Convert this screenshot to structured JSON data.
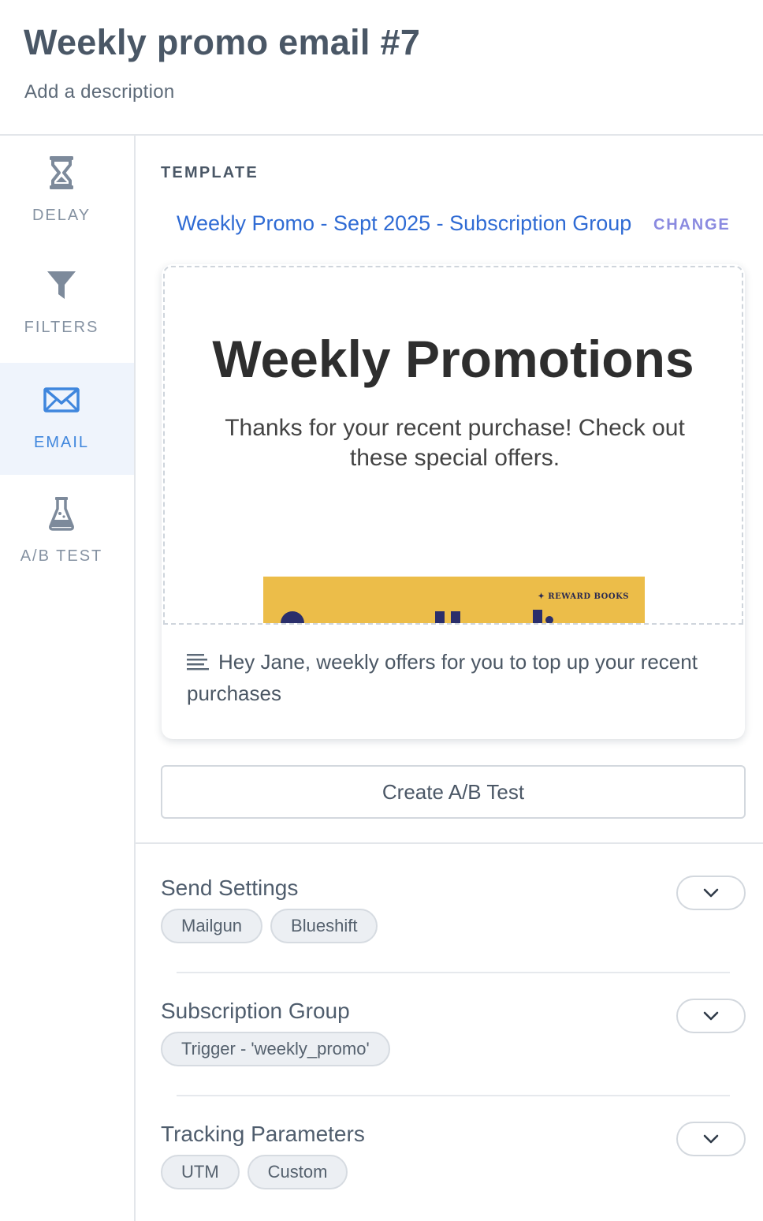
{
  "header": {
    "title": "Weekly promo email #7",
    "description": "Add a description"
  },
  "sidebar": {
    "items": [
      {
        "label": "DELAY",
        "icon": "hourglass-icon"
      },
      {
        "label": "FILTERS",
        "icon": "filter-icon"
      },
      {
        "label": "EMAIL",
        "icon": "envelope-icon",
        "active": true
      },
      {
        "label": "A/B TEST",
        "icon": "flask-icon"
      }
    ]
  },
  "template": {
    "section_label": "TEMPLATE",
    "name": "Weekly Promo - Sept 2025 - Subscription Group",
    "change_label": "CHANGE"
  },
  "preview": {
    "heading": "Weekly Promotions",
    "body": "Thanks for your recent purchase! Check out these special offers.",
    "banner_brand": "✦ REWARD BOOKS",
    "subject": "Hey Jane, weekly offers for you to top up your recent purchases"
  },
  "ab_test": {
    "button_label": "Create A/B Test"
  },
  "settings": [
    {
      "title": "Send Settings",
      "chips": [
        "Mailgun",
        "Blueshift"
      ]
    },
    {
      "title": "Subscription Group",
      "chips": [
        "Trigger - 'weekly_promo'"
      ]
    },
    {
      "title": "Tracking Parameters",
      "chips": [
        "UTM",
        "Custom"
      ]
    }
  ],
  "colors": {
    "accent": "#3f86dd",
    "link": "#2f6bd4",
    "change": "#8a8ae0",
    "active_bg": "#eff4fc",
    "banner": "#ecbd49"
  }
}
